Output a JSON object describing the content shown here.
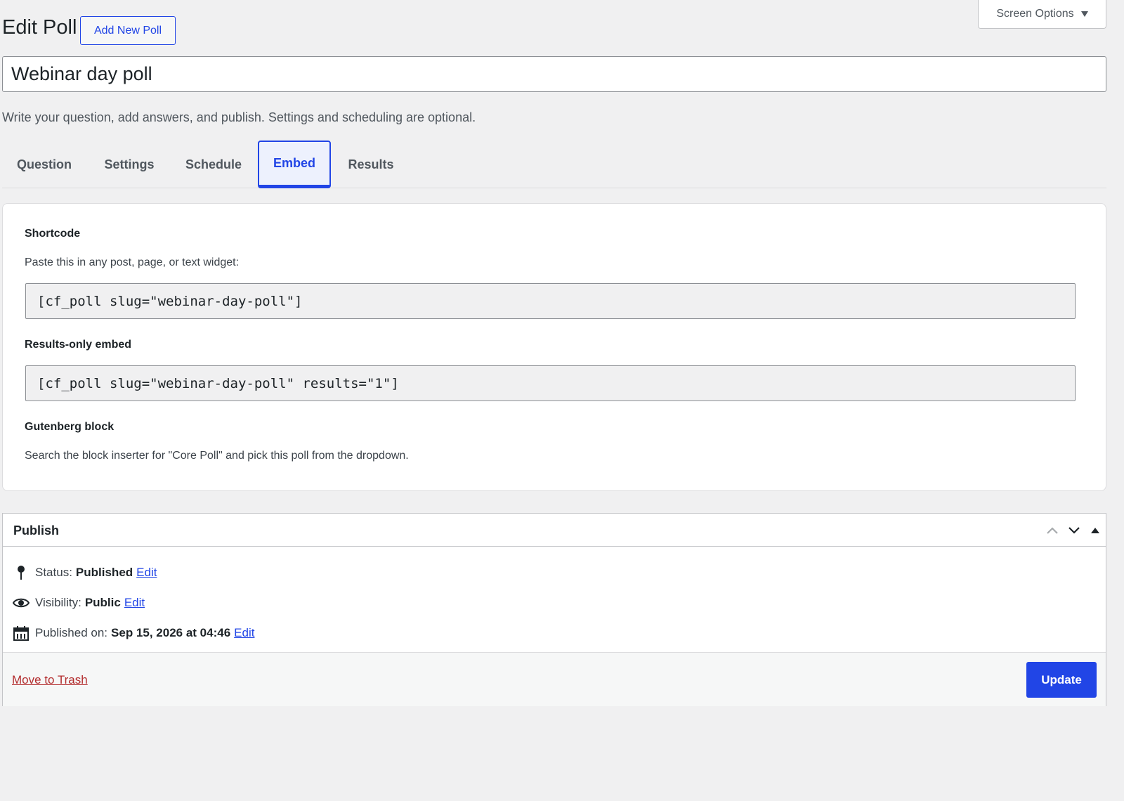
{
  "header": {
    "screen_options": "Screen Options",
    "title": "Edit Poll",
    "add_new": "Add New Poll"
  },
  "poll": {
    "title_value": "Webinar day poll",
    "hint": "Write your question, add answers, and publish. Settings and scheduling are optional."
  },
  "tabs": [
    {
      "label": "Question",
      "active": false
    },
    {
      "label": "Settings",
      "active": false
    },
    {
      "label": "Schedule",
      "active": false
    },
    {
      "label": "Embed",
      "active": true
    },
    {
      "label": "Results",
      "active": false
    }
  ],
  "embed": {
    "shortcode_label": "Shortcode",
    "shortcode_desc": "Paste this in any post, page, or text widget:",
    "shortcode_value": "[cf_poll slug=\"webinar-day-poll\"]",
    "results_label": "Results-only embed",
    "results_value": "[cf_poll slug=\"webinar-day-poll\" results=\"1\"]",
    "gutenberg_label": "Gutenberg block",
    "gutenberg_desc": "Search the block inserter for \"Core Poll\" and pick this poll from the dropdown."
  },
  "publish": {
    "title": "Publish",
    "status_label": "Status:",
    "status_value": "Published",
    "visibility_label": "Visibility:",
    "visibility_value": "Public",
    "published_label": "Published on:",
    "published_value": "Sep 15, 2026 at 04:46",
    "edit_link": "Edit",
    "trash": "Move to Trash",
    "update": "Update"
  },
  "colors": {
    "accent": "#2145e6",
    "danger": "#b32d2e",
    "background": "#f0f0f1"
  }
}
